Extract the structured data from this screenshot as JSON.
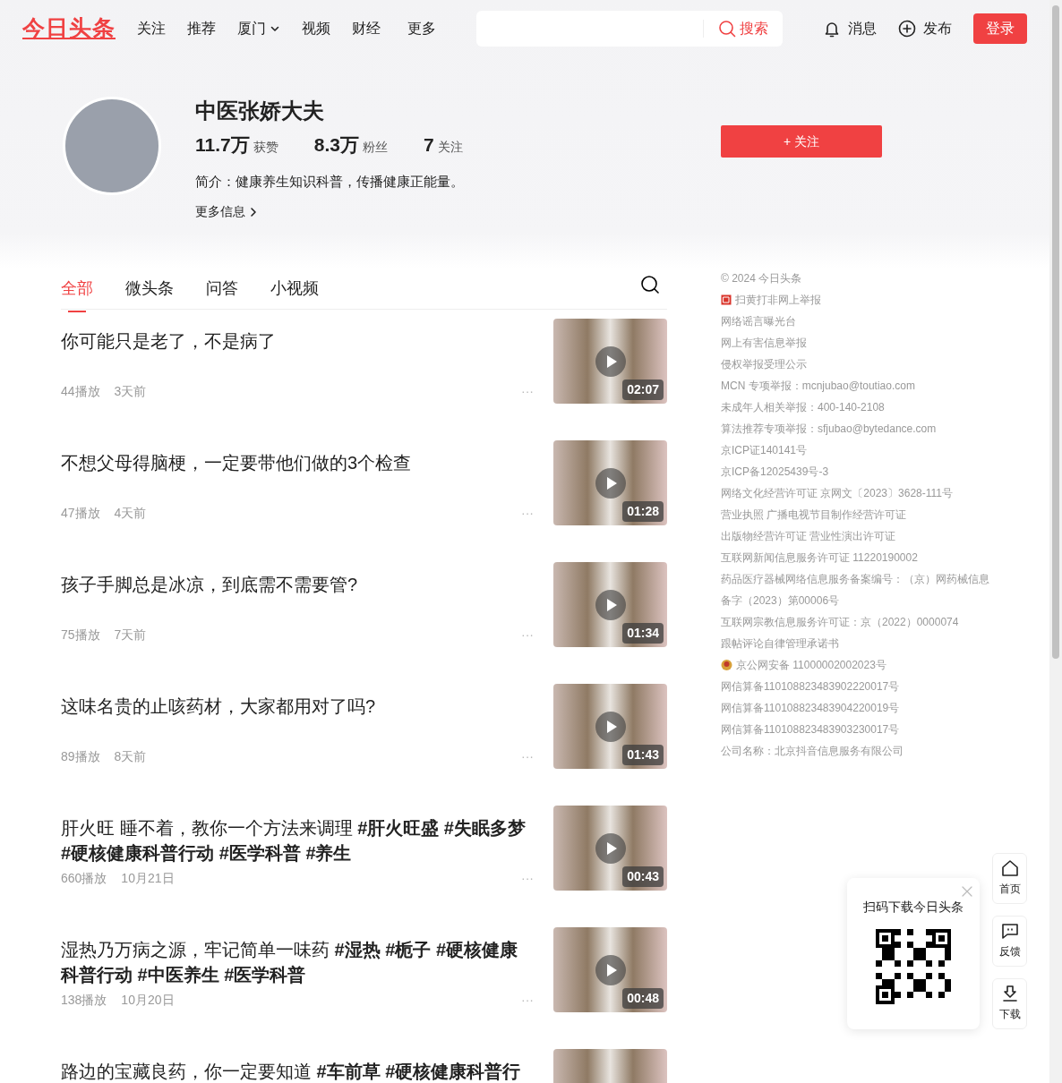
{
  "header": {
    "logo": "今日头条",
    "nav": [
      {
        "label": "关注",
        "dropdown": false
      },
      {
        "label": "推荐",
        "dropdown": false
      },
      {
        "label": "厦门",
        "dropdown": true
      },
      {
        "label": "视频",
        "dropdown": false
      },
      {
        "label": "财经",
        "dropdown": false
      },
      {
        "label": "更多",
        "dropdown": false
      }
    ],
    "search_button": "搜索",
    "messages": "消息",
    "publish": "发布",
    "login": "登录"
  },
  "profile": {
    "name": "中医张娇大夫",
    "stats": [
      {
        "value": "11.7万",
        "label": "获赞"
      },
      {
        "value": "8.3万",
        "label": "粉丝"
      },
      {
        "value": "7",
        "label": "关注"
      }
    ],
    "bio": "简介：健康养生知识科普，传播健康正能量。",
    "more_info": "更多信息",
    "follow_button": "+ 关注"
  },
  "tabs": [
    {
      "label": "全部",
      "selected": true
    },
    {
      "label": "微头条",
      "selected": false
    },
    {
      "label": "问答",
      "selected": false
    },
    {
      "label": "小视频",
      "selected": false
    }
  ],
  "articles": [
    {
      "title": "你可能只是老了，不是病了",
      "plays": "44播放",
      "time": "3天前",
      "more": "···",
      "duration": "02:07"
    },
    {
      "title": "不想父母得脑梗，一定要带他们做的3个检查",
      "plays": "47播放",
      "time": "4天前",
      "more": "···",
      "duration": "01:28"
    },
    {
      "title": "孩子手脚总是冰凉，到底需不需要管?",
      "plays": "75播放",
      "time": "7天前",
      "more": "···",
      "duration": "01:34"
    },
    {
      "title": "这味名贵的止咳药材，大家都用对了吗?",
      "plays": "89播放",
      "time": "8天前",
      "more": "···",
      "duration": "01:43"
    },
    {
      "title": "肝火旺 睡不着，教你一个方法来调理 **#肝火旺盛** **#失眠多梦** **#硬核健康科普行动** **#医学科普** **#养生**",
      "plays": "660播放",
      "time": "10月21日",
      "more": "···",
      "duration": "00:43"
    },
    {
      "title": "湿热乃万病之源，牢记简单一味药 **#湿热** **#栀子** **#硬核健康科普行动** **#中医养生** **#医学科普**",
      "plays": "138播放",
      "time": "10月20日",
      "more": "···",
      "duration": "00:48"
    },
    {
      "title": "路边的宝藏良药，你一定要知道 **#车前草** **#硬核健康科普行**"
    }
  ],
  "footer_links": [
    {
      "text": "© 2024 今日头条",
      "kind": "text"
    },
    {
      "text": "扫黄打非网上举报",
      "kind": "report"
    },
    {
      "text": "网络谣言曝光台",
      "kind": "text"
    },
    {
      "text": "网上有害信息举报",
      "kind": "text"
    },
    {
      "text": "侵权举报受理公示",
      "kind": "text"
    },
    {
      "text": "MCN 专项举报：mcnjubao@toutiao.com",
      "kind": "text"
    },
    {
      "text": "未成年人相关举报：400-140-2108",
      "kind": "text"
    },
    {
      "text": "算法推荐专项举报：sfjubao@bytedance.com",
      "kind": "text"
    },
    {
      "text": "京ICP证140141号",
      "kind": "text"
    },
    {
      "text": "京ICP备12025439号-3",
      "kind": "text"
    },
    {
      "text": "网络文化经营许可证 京网文〔2023〕3628-111号",
      "kind": "text"
    },
    {
      "text": "营业执照 广播电视节目制作经营许可证",
      "kind": "text"
    },
    {
      "text": "出版物经营许可证 营业性演出许可证",
      "kind": "text"
    },
    {
      "text": "互联网新闻信息服务许可证 11220190002",
      "kind": "text"
    },
    {
      "text": "药品医疗器械网络信息服务备案编号：（京）网药械信息",
      "kind": "text"
    },
    {
      "text": "备字（2023）第00006号",
      "kind": "text"
    },
    {
      "text": "互联网宗教信息服务许可证：京（2022）0000074",
      "kind": "text"
    },
    {
      "text": "跟帖评论自律管理承诺书",
      "kind": "text"
    },
    {
      "text": "京公网安备 11000002002023号",
      "kind": "police"
    },
    {
      "text": "网信算备110108823483902220017号",
      "kind": "text"
    },
    {
      "text": "网信算备110108823483904220019号",
      "kind": "text"
    },
    {
      "text": "网信算备110108823483903230017号",
      "kind": "text"
    },
    {
      "text": "公司名称：北京抖音信息服务有限公司",
      "kind": "text"
    }
  ],
  "qr_popup": {
    "title": "扫码下载今日头条"
  },
  "side_buttons": [
    {
      "kind": "home",
      "label": "首页"
    },
    {
      "kind": "feedback",
      "label": "反馈"
    },
    {
      "kind": "download",
      "label": "下载"
    }
  ]
}
